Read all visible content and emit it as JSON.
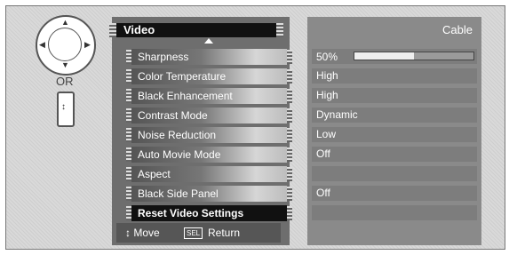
{
  "remote": {
    "dpad_icon": "dpad-icon",
    "or_label": "OR",
    "rocker_icon": "channel-rocker-icon"
  },
  "menu": {
    "title": "Video",
    "source": "Cable",
    "items": [
      {
        "label": "Sharpness"
      },
      {
        "label": "Color Temperature"
      },
      {
        "label": "Black Enhancement"
      },
      {
        "label": "Contrast Mode"
      },
      {
        "label": "Noise Reduction"
      },
      {
        "label": "Auto Movie Mode"
      },
      {
        "label": "Aspect"
      },
      {
        "label": "Black Side Panel"
      },
      {
        "label": "Reset Video Settings",
        "selected": true
      }
    ]
  },
  "values": {
    "sharpness_percent": "50%",
    "sharpness_level": 0.5,
    "color_temperature": "High",
    "black_enhancement": "High",
    "contrast_mode": "Dynamic",
    "noise_reduction": "Low",
    "auto_movie_mode": "Off",
    "black_side_panel": "Off"
  },
  "help": {
    "move_label": "Move",
    "sel_key": "SEL",
    "return_label": "Return"
  },
  "colors": {
    "selected_row": "#111111",
    "panel_bg": "#6e6e6e",
    "value_bg": "#7d7d7d"
  }
}
